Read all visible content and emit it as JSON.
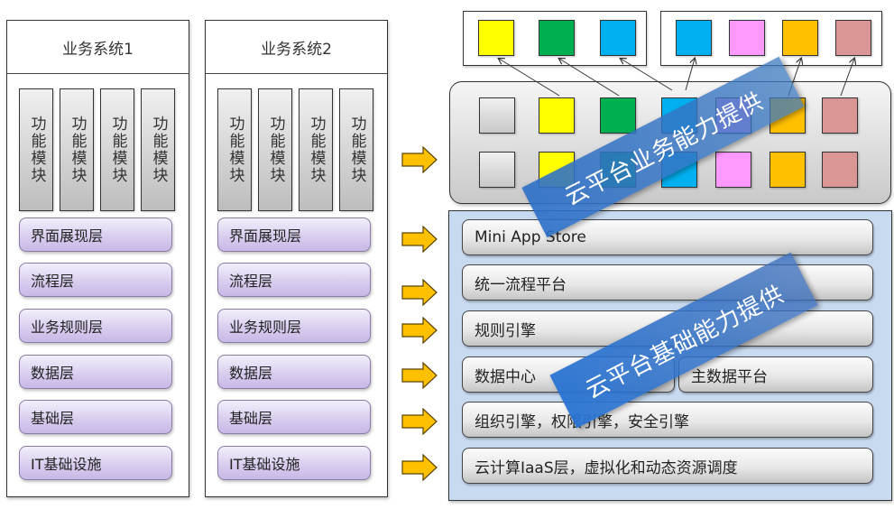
{
  "systems": [
    {
      "title": "业务系统1",
      "modules": [
        "功能模块",
        "功能模块",
        "功能模块",
        "功能模块"
      ],
      "layers": [
        "界面展现层",
        "流程层",
        "业务规则层",
        "数据层",
        "基础层",
        "IT基础设施"
      ]
    },
    {
      "title": "业务系统2",
      "modules": [
        "功能模块",
        "功能模块",
        "功能模块",
        "功能模块"
      ],
      "layers": [
        "界面展现层",
        "流程层",
        "业务规则层",
        "数据层",
        "基础层",
        "IT基础设施"
      ]
    }
  ],
  "apps": {
    "group_a": [
      "#ffff00",
      "#00b050",
      "#00b0f0"
    ],
    "group_b": [
      "#00b0f0",
      "#ff99ff",
      "#ffc000",
      "#da9694"
    ]
  },
  "business_capability": {
    "row1": [
      "#d9d9d9",
      "#ffff00",
      "#00b050",
      "#00b0f0",
      "#ff99ff",
      "#ffc000",
      "#da9694"
    ],
    "row2": [
      "#d9d9d9",
      "#ffff00",
      "#00b050",
      "#00b0f0",
      "#ff99ff",
      "#ffc000",
      "#da9694"
    ],
    "banner": "云平台业务能力提供"
  },
  "base_capability": {
    "bars": [
      "Mini App Store",
      "统一流程平台",
      "规则引擎",
      "数据中心",
      "组织引擎，权限引擎，安全引擎",
      "云计算IaaS层，虚拟化和动态资源调度"
    ],
    "data_split_right": "主数据平台",
    "banner": "云平台基础能力提供"
  },
  "colors": {
    "arrow_fill": "#ffc000",
    "layer_purple": "#d7cbee",
    "base_panel_blue": "#c8daf0",
    "banner_blue": "#2e70c8"
  }
}
